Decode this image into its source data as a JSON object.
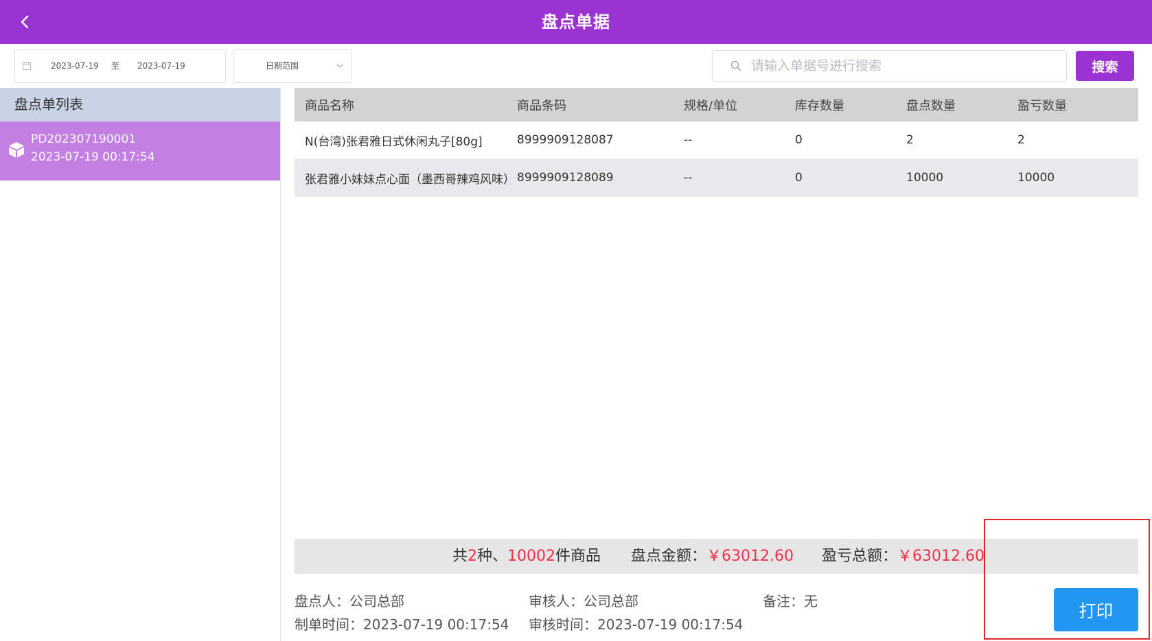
{
  "header": {
    "title": "盘点单据"
  },
  "toolbar": {
    "start_date": "2023-07-19",
    "range_sep": "至",
    "end_date": "2023-07-19",
    "range_select": "日期范围",
    "search_placeholder": "请输入单据号进行搜索",
    "search_label": "搜索"
  },
  "sidebar": {
    "title": "盘点单列表",
    "items": [
      {
        "no": "PD202307190001",
        "time": "2023-07-19 00:17:54"
      }
    ]
  },
  "table": {
    "headers": [
      "商品名称",
      "商品条码",
      "规格/单位",
      "库存数量",
      "盘点数量",
      "盈亏数量"
    ],
    "rows": [
      [
        "N(台湾)张君雅日式休闲丸子[80g]",
        "8999909128087",
        "--",
        "0",
        "2",
        "2"
      ],
      [
        "张君雅小妹妹点心面（墨西哥辣鸡风味）",
        "8999909128089",
        "--",
        "0",
        "10000",
        "10000"
      ]
    ]
  },
  "summary": {
    "prefix": "共",
    "kinds": "2",
    "kinds_suffix": "种、",
    "count": "10002",
    "count_suffix": "件商品",
    "amount_label": "盘点金额：",
    "amount": "￥63012.60",
    "profit_label": "盈亏总额：",
    "profit": "￥63012.60"
  },
  "meta": {
    "counter": "盘点人：公司总部",
    "reviewer": "审核人：公司总部",
    "remark": "备注：无",
    "created": "制单时间：2023-07-19 00:17:54",
    "reviewed": "审核时间：2023-07-19 00:17:54"
  },
  "actions": {
    "print_label": "打印"
  },
  "colors": {
    "brand": "#9a33d1",
    "selected_item": "#c47fe3",
    "highlight": "#f2304a",
    "print_button": "#2196f3"
  }
}
